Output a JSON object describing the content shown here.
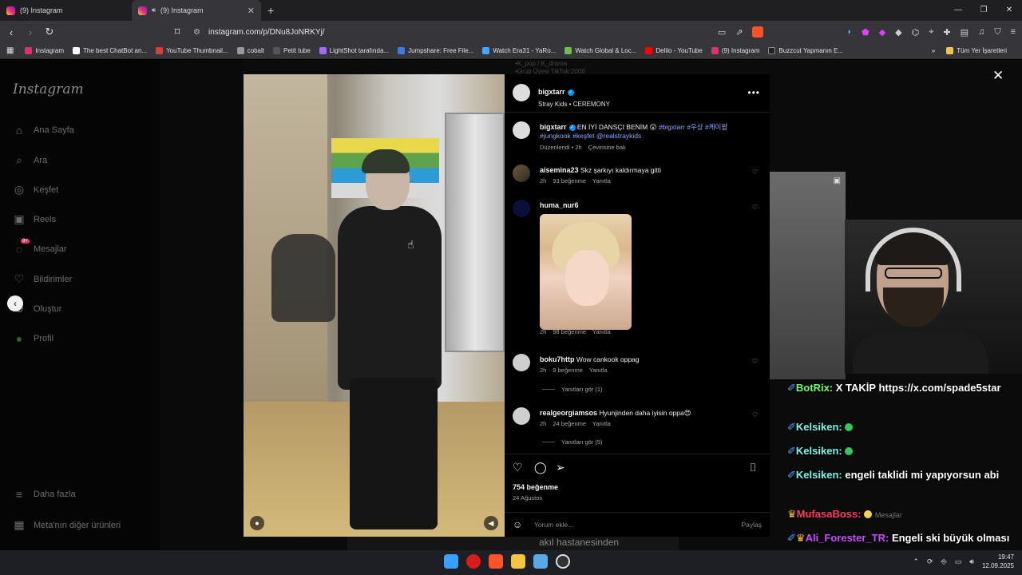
{
  "browser": {
    "tabs": [
      {
        "label": "(9) Instagram",
        "active": false
      },
      {
        "label": "(9) Instagram",
        "active": true
      }
    ],
    "new_tab": "+",
    "window_controls": [
      "—",
      "❐",
      "✕"
    ],
    "url": "instagram.com/p/DNu8JoNRKYj/",
    "bookmarks": [
      {
        "label": "Instagram",
        "color": "#e1306c"
      },
      {
        "label": "The best ChatBot an...",
        "color": "#ffffff"
      },
      {
        "label": "YouTube Thumbnail...",
        "color": "#e53935"
      },
      {
        "label": "cobalt",
        "color": "#999999"
      },
      {
        "label": "Petit tube",
        "color": "#555555"
      },
      {
        "label": "LightShot tarafında...",
        "color": "#a06bf5"
      },
      {
        "label": "Jumpshare: Free File...",
        "color": "#3d7be0"
      },
      {
        "label": "Watch Era31 - YaRo...",
        "color": "#4aa3ff"
      },
      {
        "label": "Watch Global & Loc...",
        "color": "#6cc04a"
      },
      {
        "label": "Delilo - YouTube",
        "color": "#ff0000"
      },
      {
        "label": "(9) Instagram",
        "color": "#e1306c"
      },
      {
        "label": "Buzzcut Yapmanın E...",
        "color": "#222222"
      }
    ],
    "bookmarks_more": "»",
    "all_bookmarks": "Tüm Yer İşaretleri"
  },
  "instagram": {
    "logo": "Instagram",
    "nav": [
      {
        "label": "Ana Sayfa",
        "icon": "home-icon",
        "glyph": "⌂"
      },
      {
        "label": "Ara",
        "icon": "search-icon",
        "glyph": "⌕"
      },
      {
        "label": "Keşfet",
        "icon": "compass-icon",
        "glyph": "◎"
      },
      {
        "label": "Reels",
        "icon": "reels-icon",
        "glyph": "▣"
      },
      {
        "label": "Mesajlar",
        "icon": "messenger-icon",
        "glyph": "◌"
      },
      {
        "label": "Bildirimler",
        "icon": "heart-icon",
        "glyph": "♡"
      },
      {
        "label": "Oluştur",
        "icon": "create-icon",
        "glyph": "⊕"
      },
      {
        "label": "Profil",
        "icon": "profile-avatar-icon",
        "glyph": "●"
      }
    ],
    "messages_badge": "9+",
    "more": {
      "label": "Daha fazla",
      "glyph": "≡"
    },
    "meta": {
      "label": "Meta'nın diğer ürünleri",
      "glyph": "▦"
    },
    "bg_text": [
      "•K_pop / K_drama",
      "•Grup Üyesi  TikTok:2008"
    ],
    "bottom_text": "akıl hastanesinden"
  },
  "post": {
    "author": "bigxtarr",
    "audio": "Stray Kids • CEREMONY",
    "more": "•••",
    "caption_user": "bigxtarr",
    "caption": "EN İYİ DANSÇI BENİM 😮",
    "caption_tags": "#bigxtarr #우상 #케이팝",
    "caption_tags2": "#jungkook #keşfet @realstraykids",
    "caption_time": "Düzenlendi • 2h",
    "caption_translate": "Çevirisine bak",
    "comments": [
      {
        "user": "aisemina23",
        "text": "Skz şarkıyı kaldırmaya gitti",
        "time": "2h",
        "likes": "93 beğenme",
        "reply": "Yanıtla"
      },
      {
        "user": "huma_nur6",
        "text": "",
        "time": "2h",
        "likes": "98 beğenme",
        "reply": "Yanıtla"
      },
      {
        "user": "boku7http",
        "text": "Wow cankook oppag",
        "time": "2h",
        "likes": "9 beğenme",
        "reply": "Yanıtla",
        "view_replies": "Yanıtları gör (1)"
      },
      {
        "user": "realgeorgiamsos",
        "text": "Hyunjinden daha iyisin oppa😍",
        "time": "2h",
        "likes": "24 beğenme",
        "reply": "Yanıtla",
        "view_replies": "Yanıtları gör (5)"
      }
    ],
    "like_count": "754 beğenme",
    "date": "24 Ağustos",
    "comment_placeholder": "Yorum ekle...",
    "share_label": "Paylaş"
  },
  "chat": [
    {
      "name": "BotRix:",
      "name_color": "#6cff6c",
      "text": "X TAKİP https://x.com/spade5star"
    },
    {
      "name": "Kelsiken:",
      "name_color": "#7af5e6",
      "text": ""
    },
    {
      "name": "Kelsiken:",
      "name_color": "#7af5e6",
      "text": ""
    },
    {
      "name": "Kelsiken:",
      "name_color": "#7af5e6",
      "text": "engeli taklidi mi yapıyorsun abi"
    },
    {
      "name": "MufasaBoss:",
      "name_color": "#ff3b5c",
      "text": ""
    },
    {
      "name": "Ali_Forester_TR:",
      "name_color": "#c84bff",
      "text": "Engeli ski büyük olması"
    }
  ],
  "chat_faint": "Mesajlar",
  "taskbar": {
    "time": "19:47",
    "date": "12.09.2025"
  }
}
